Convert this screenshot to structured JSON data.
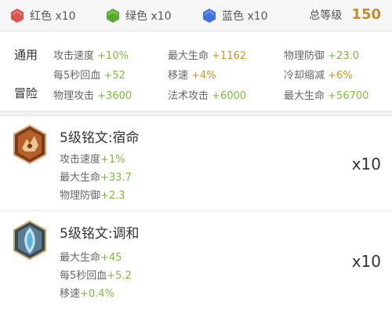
{
  "colors": {
    "accent_green": "#7dbb3f",
    "accent_gold": "#c58a2d",
    "red_gem": "#d9534f",
    "green_gem": "#5aa833",
    "blue_gem": "#3f72d9"
  },
  "gems": {
    "red": {
      "label": "红色 x10",
      "icon": "red-hexagon-icon"
    },
    "green": {
      "label": "绿色 x10",
      "icon": "green-hexagon-icon"
    },
    "blue": {
      "label": "蓝色 x10",
      "icon": "blue-hexagon-icon"
    }
  },
  "level": {
    "label": "总等级",
    "value": "150"
  },
  "stats": {
    "general_label": "通用",
    "adventure_label": "冒险",
    "rows": [
      [
        {
          "name": "攻击速度",
          "value": "+10%"
        },
        {
          "name": "最大生命",
          "value": "+1162"
        },
        {
          "name": "物理防御",
          "value": "+23.0"
        }
      ],
      [
        {
          "name": "每5秒回血",
          "value": "+52"
        },
        {
          "name": "移速",
          "value": "+4%"
        },
        {
          "name": "冷却缩减",
          "value": "+6%"
        }
      ],
      [
        {
          "name": "物理攻击",
          "value": "+3600"
        },
        {
          "name": "法术攻击",
          "value": "+6000"
        },
        {
          "name": "最大生命",
          "value": "+56700"
        }
      ]
    ]
  },
  "runes": [
    {
      "title": "5级铭文:宿命",
      "icon": "fate-rune-icon",
      "count": "x10",
      "lines": [
        {
          "name": "攻击速度",
          "value": "+1%"
        },
        {
          "name": "最大生命",
          "value": "+33.7"
        },
        {
          "name": "物理防御",
          "value": "+2.3"
        }
      ]
    },
    {
      "title": "5级铭文:调和",
      "icon": "harmony-rune-icon",
      "count": "x10",
      "lines": [
        {
          "name": "最大生命",
          "value": "+45"
        },
        {
          "name": "每5秒回血",
          "value": "+5.2"
        },
        {
          "name": "移速",
          "value": "+0.4%"
        }
      ]
    }
  ]
}
